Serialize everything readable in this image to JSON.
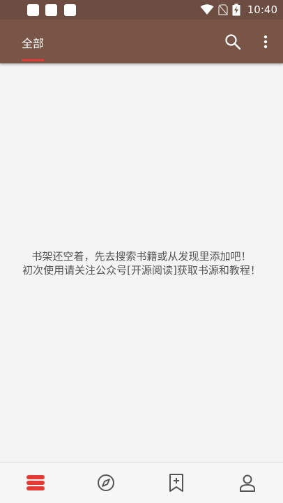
{
  "status_bar": {
    "time": "10:40",
    "icons": [
      "notification-icon",
      "notification-icon",
      "notification-icon",
      "wifi-icon",
      "no-sim-icon",
      "battery-charging-icon"
    ]
  },
  "app_bar": {
    "tab_label": "全部",
    "actions": [
      "search-icon",
      "more-vert-icon"
    ]
  },
  "empty_state": {
    "line1": "书架还空着，先去搜索书籍或从发现里添加吧！",
    "line2": "初次使用请关注公众号[开源阅读]获取书源和教程！"
  },
  "bottom_nav": {
    "items": [
      {
        "icon": "bookshelf-icon",
        "selected": true
      },
      {
        "icon": "compass-icon",
        "selected": false
      },
      {
        "icon": "rss-bookmark-icon",
        "selected": false
      },
      {
        "icon": "person-icon",
        "selected": false
      }
    ]
  },
  "colors": {
    "status_bar": "#6d4c41",
    "app_bar": "#795548",
    "accent": "#e53935",
    "background": "#f4f4f4",
    "icon_gray": "#555555"
  }
}
